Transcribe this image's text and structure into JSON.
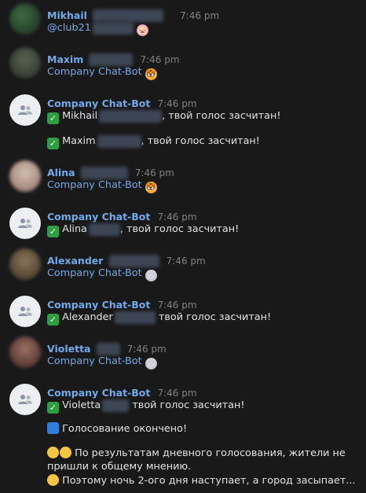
{
  "messages": [
    {
      "author": "Mikhail",
      "time": "7:46 pm",
      "text_prefix": "@club21",
      "emoji": "pig-face-emoji",
      "avatar_color": "#2c4a2e"
    },
    {
      "author": "Maxim",
      "time": "7:46 pm",
      "text": "Company Chat-Bot",
      "emoji": "tiger-face-emoji",
      "avatar_color": "#3a4538"
    },
    {
      "author": "Company Chat-Bot",
      "time": "7:46 pm",
      "lines": [
        {
          "name": "Mikhail",
          "suffix": ", твой голос засчитан!"
        },
        {
          "name": "Maxim",
          "suffix": ", твой голос засчитан!"
        }
      ]
    },
    {
      "author": "Alina",
      "time": "7:46 pm",
      "text": "Company Chat-Bot",
      "emoji": "tiger-face-emoji",
      "avatar_color": "#b89a8c"
    },
    {
      "author": "Company Chat-Bot",
      "time": "7:46 pm",
      "lines": [
        {
          "name": "Alina",
          "suffix": ", твой голос засчитан!"
        }
      ]
    },
    {
      "author": "Alexander",
      "time": "7:46 pm",
      "text": "Company Chat-Bot",
      "emoji": "mouse-face-emoji",
      "avatar_color": "#6b5a44"
    },
    {
      "author": "Company Chat-Bot",
      "time": "7:46 pm",
      "lines": [
        {
          "name": "Alexander",
          "suffix": " твой голос засчитан!"
        }
      ]
    },
    {
      "author": "Violetta",
      "time": "7:46 pm",
      "text": "Company Chat-Bot",
      "emoji": "mouse-face-emoji",
      "avatar_color": "#7a5248"
    },
    {
      "author": "Company Chat-Bot",
      "time": "7:46 pm",
      "lines": [
        {
          "name": "Violetta",
          "suffix": " твой голос засчитан!"
        }
      ],
      "extra": {
        "voting_over": "Голосование окончено!",
        "result_line1": "По результатам дневного голосования, жители не",
        "result_line2": "пришли к общему мнению.",
        "night_line": "Поэтому ночь 2-ого дня наступает, а город засыпает..."
      }
    }
  ],
  "colors": {
    "background": "#19191a",
    "link": "#71aaeb",
    "text": "#e1e3e6",
    "time": "#828282",
    "check": "#2ea043"
  }
}
